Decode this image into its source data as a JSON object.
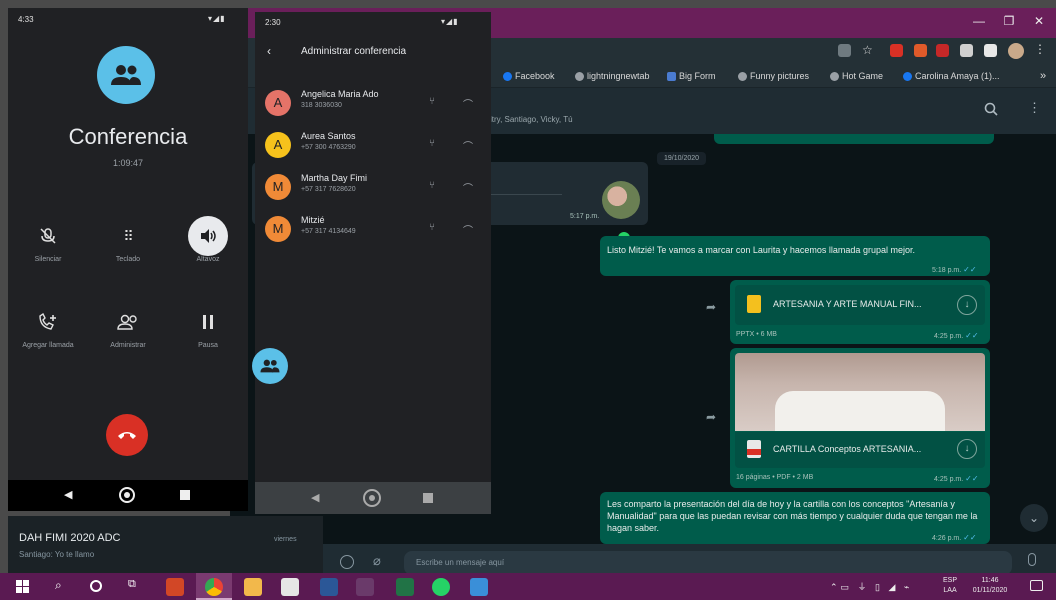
{
  "chrome": {
    "bookmarks": [
      {
        "label": "Facebook",
        "icon": "facebook-icon",
        "color": "#1877f2"
      },
      {
        "label": "lightningnewtab",
        "icon": "globe-icon",
        "color": "#9aa0a6"
      },
      {
        "label": "Big Form",
        "icon": "form-icon",
        "color": "#4a7bd0"
      },
      {
        "label": "Funny pictures",
        "icon": "globe-icon",
        "color": "#9aa0a6"
      },
      {
        "label": "Hot Game",
        "icon": "globe-icon",
        "color": "#9aa0a6"
      },
      {
        "label": "Carolina Amaya (1)...",
        "icon": "facebook-icon",
        "color": "#1877f2"
      }
    ],
    "bookmarks_more": "»",
    "window_controls": {
      "minimize": "—",
      "maximize": "❐",
      "close": "✕"
    }
  },
  "whatsapp": {
    "header": {
      "subtitle": "itry, Santiago, Vicky, Tú"
    },
    "date_chip": "19/10/2020",
    "incoming": {
      "time": "5:17 p.m."
    },
    "messages": [
      {
        "text": "Listo Mitzié! Te vamos a marcar con Laurita y hacemos llamada grupal mejor.",
        "time": "5:18 p.m."
      },
      {
        "doc_title": "ARTESANIA Y ARTE MANUAL FIN...",
        "doc_meta": "PPTX • 6 MB",
        "time": "4:25 p.m."
      },
      {
        "doc_title": "CARTILLA Conceptos ARTESANIA...",
        "doc_meta": "16 páginas • PDF • 2 MB",
        "time": "4:25 p.m."
      },
      {
        "text": "Les comparto la presentación del día de hoy y la cartilla con los conceptos \"Artesanía y Manualidad\" para que las puedan revisar con más tiempo y cualquier duda que tengan me la hagan saber.",
        "time": "4:26 p.m."
      }
    ],
    "input_placeholder": "Escribe un mensaje aquí"
  },
  "phone1": {
    "status_time": "4:33",
    "title": "Conferencia",
    "timer": "1:09:47",
    "buttons": [
      {
        "label": "Silenciar",
        "icon": "mic-off-icon"
      },
      {
        "label": "Teclado",
        "icon": "dialpad-icon"
      },
      {
        "label": "Altavoz",
        "icon": "speaker-icon"
      },
      {
        "label": "Agregar llamada",
        "icon": "add-call-icon"
      },
      {
        "label": "Administrar",
        "icon": "manage-icon"
      },
      {
        "label": "Pausa",
        "icon": "pause-icon"
      }
    ],
    "colors": {
      "avatar": "#5bc0e8",
      "hangup": "#d93025"
    }
  },
  "phone2": {
    "status_time": "2:30",
    "title": "Administrar conferencia",
    "participants": [
      {
        "initial": "A",
        "name": "Angelica Maria Ado",
        "number": "318 3036030",
        "color": "#e57368"
      },
      {
        "initial": "A",
        "name": "Aurea Santos",
        "number": "+57 300 4763290",
        "color": "#f6c21c"
      },
      {
        "initial": "M",
        "name": "Martha Day Fimi",
        "number": "+57 317 7628620",
        "color": "#f08a37"
      },
      {
        "initial": "M",
        "name": "Mitzié",
        "number": "+57 317 4134649",
        "color": "#f08a37"
      }
    ]
  },
  "notification": {
    "title": "DAH FIMI 2020 ADC",
    "subtitle": "Santiago: Yo te llamo",
    "day": "viernes"
  },
  "taskbar": {
    "lang": "ESP",
    "region": "LAA",
    "time": "11:46",
    "date": "01/11/2020"
  }
}
